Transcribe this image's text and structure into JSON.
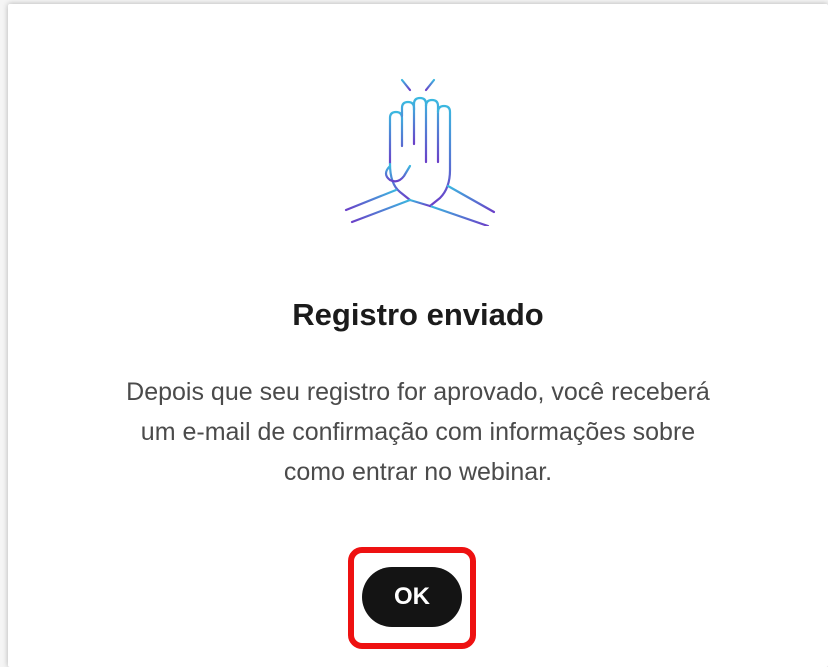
{
  "dialog": {
    "illustration_icon": "high-five-icon",
    "title": "Registro enviado",
    "message_lines": [
      "Depois que seu registro for aprovado, você receberá",
      "um e-mail de confirmação com informações sobre",
      "como entrar no webinar."
    ],
    "ok_label": "OK"
  },
  "colors": {
    "title": "#1b1b1b",
    "message": "#4b4b4b",
    "button_bg": "#141414",
    "button_text": "#ffffff",
    "highlight_border": "#ee1111",
    "icon_gradient_top": "#3bb8e0",
    "icon_gradient_bottom": "#6a3fc8"
  }
}
